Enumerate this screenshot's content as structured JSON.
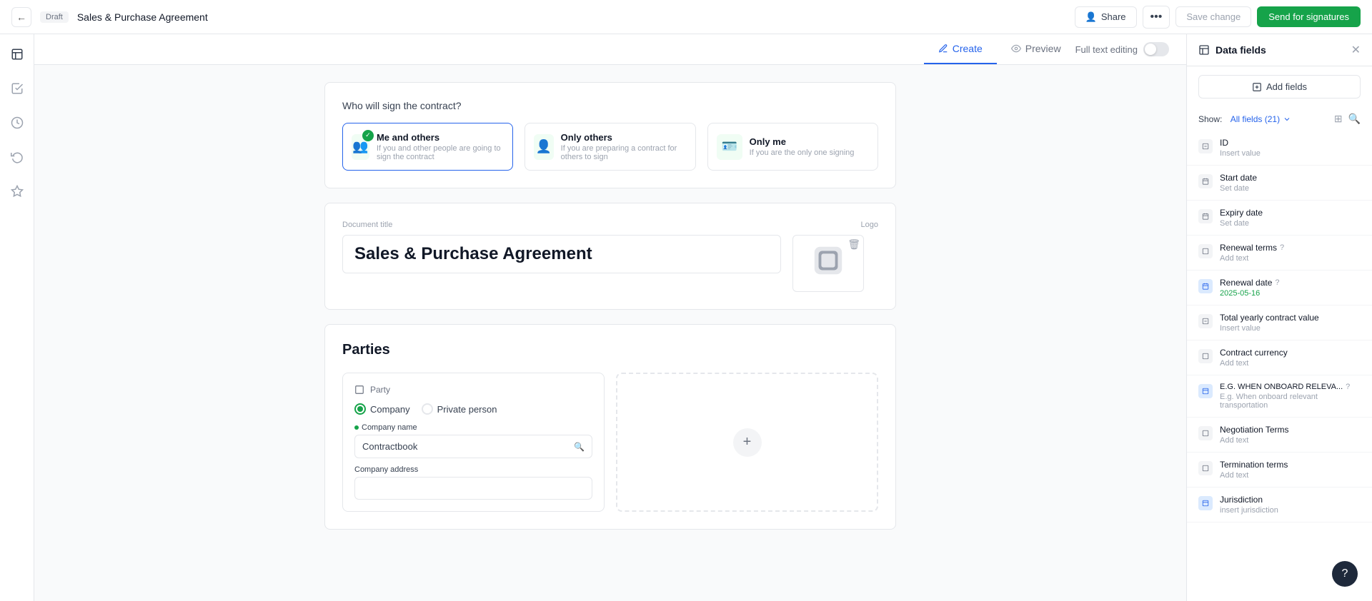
{
  "topbar": {
    "back_label": "←",
    "badge": "Draft",
    "title": "Sales & Purchase Agreement",
    "share_label": "Share",
    "dots_label": "•••",
    "save_label": "Save change",
    "send_label": "Send for signatures"
  },
  "tabs": {
    "create_label": "Create",
    "preview_label": "Preview",
    "editing_label": "Full text editing"
  },
  "sign_section": {
    "question": "Who will sign the contract?",
    "options": [
      {
        "title": "Me and others",
        "desc": "If you and other people are going to sign the contract",
        "selected": true
      },
      {
        "title": "Only others",
        "desc": "If you are preparing a contract for others to sign",
        "selected": false
      },
      {
        "title": "Only me",
        "desc": "If you are the only one signing",
        "selected": false
      }
    ]
  },
  "document": {
    "title_label": "Document title",
    "title_value": "Sales & Purchase Agreement",
    "logo_label": "Logo"
  },
  "parties": {
    "title": "Parties",
    "party_label": "Party",
    "company_label": "Company",
    "private_label": "Private person",
    "company_name_label": "Company name",
    "company_name_value": "Contractbook",
    "company_address_label": "Company address"
  },
  "data_fields_panel": {
    "title": "Data fields",
    "add_label": "Add fields",
    "show_label": "Show:",
    "filter_label": "All fields (21)",
    "fields": [
      {
        "name": "ID",
        "value": "Insert value",
        "icon_type": "gray"
      },
      {
        "name": "Start date",
        "value": "Set date",
        "icon_type": "gray"
      },
      {
        "name": "Expiry date",
        "value": "Set date",
        "icon_type": "gray"
      },
      {
        "name": "Renewal terms",
        "value": "Add text",
        "icon_type": "gray",
        "has_help": true
      },
      {
        "name": "Renewal date",
        "value": "2025-05-16",
        "icon_type": "blue",
        "value_color": "green",
        "has_help": true
      },
      {
        "name": "Total yearly contract value",
        "value": "Insert value",
        "icon_type": "gray"
      },
      {
        "name": "Contract currency",
        "value": "Add text",
        "icon_type": "gray"
      },
      {
        "name": "E.G. WHEN ONBOARD RELEVA...",
        "value": "E.g. When onboard relevant transportation",
        "icon_type": "blue",
        "has_help": true
      },
      {
        "name": "Negotiation Terms",
        "value": "Add text",
        "icon_type": "gray"
      },
      {
        "name": "Termination terms",
        "value": "Add text",
        "icon_type": "gray"
      },
      {
        "name": "Jurisdiction",
        "value": "insert jurisdiction",
        "icon_type": "blue"
      }
    ]
  }
}
